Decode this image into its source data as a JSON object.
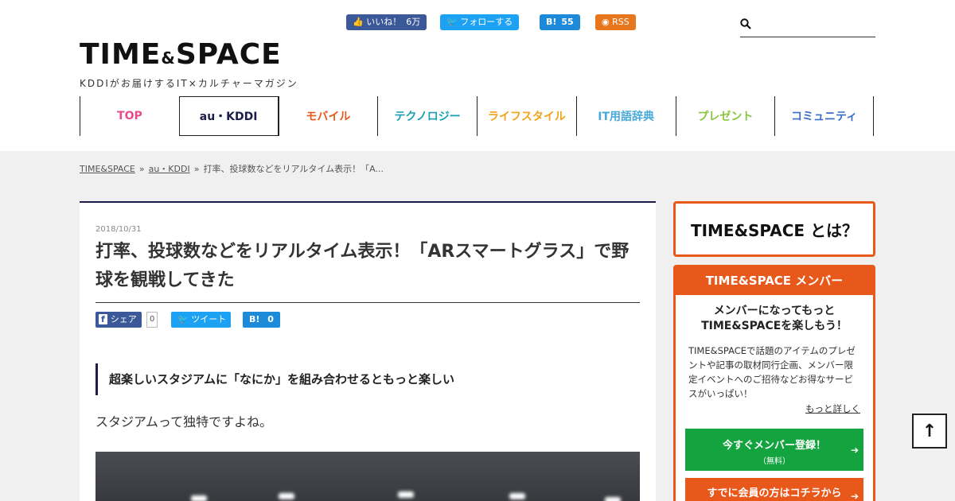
{
  "header": {
    "logo_main": "TIME",
    "logo_amp": "&",
    "logo_main2": "SPACE",
    "logo_sub": "KDDIがお届けするIT×カルチャーマガジン",
    "social": {
      "fb_like_label": "いいね！",
      "fb_like_count": "6万",
      "tw_follow_label": "フォローする",
      "hb_label": "B!",
      "hb_count": "55",
      "rss_label": "RSS"
    },
    "search": {
      "placeholder": ""
    }
  },
  "nav": {
    "items": [
      {
        "label": "TOP",
        "color": "#e84c8b"
      },
      {
        "label": "au・KDDI",
        "color": "#1b1c4a"
      },
      {
        "label": "モバイル",
        "color": "#e8581b"
      },
      {
        "label": "テクノロジー",
        "color": "#1a9fb5"
      },
      {
        "label": "ライフスタイル",
        "color": "#f2a31b"
      },
      {
        "label": "IT用語辞典",
        "color": "#4aa8d8"
      },
      {
        "label": "プレゼント",
        "color": "#8bc53f"
      },
      {
        "label": "コミュニティ",
        "color": "#3a6fc8"
      }
    ]
  },
  "breadcrumb": {
    "home": "TIME&SPACE",
    "category": "au・KDDI",
    "current": "打率、投球数などをリアルタイム表示！「A..."
  },
  "article": {
    "date": "2018/10/31",
    "title": "打率、投球数などをリアルタイム表示！「ARスマートグラス」で野球を観戦してきた",
    "share": {
      "fb_label": "シェア",
      "fb_count": "0",
      "tw_label": "ツイート",
      "hb_label": "B!",
      "hb_count": "0"
    },
    "lead": "超楽しいスタジアムに「なにか」を組み合わせるともっと楽しい",
    "body": "スタジアムって独特ですよね。"
  },
  "sidebar": {
    "about_label": "TIME&SPACE とは？",
    "member": {
      "header": "TIME&SPACE メンバー",
      "catch_line1": "メンバーになってもっと",
      "catch_line2": "TIME&SPACEを楽しもう！",
      "description": "TIME&SPACEで話題のアイテムのプレゼントや記事の取材同行企画、メンバー限定イベントへのご招待などお得なサービスがいっぱい！",
      "more_link": "もっと詳しく",
      "register_label": "今すぐメンバー登録！",
      "register_sub": "（無料）",
      "login_label": "すでに会員の方はコチラから"
    }
  },
  "to_top_label": "↑",
  "colors": {
    "accent_orange": "#e8581b",
    "navy": "#1b1c4a",
    "register_green": "#13a43f"
  }
}
